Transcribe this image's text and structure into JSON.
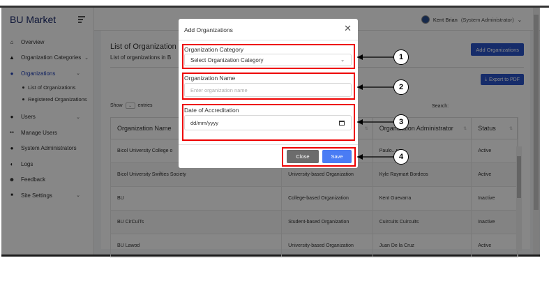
{
  "app": {
    "brand": "BU Market"
  },
  "header": {
    "user_name": "Kent Brian",
    "user_role": "(System Administrator)",
    "chevron": "⌄"
  },
  "sidebar": {
    "items": [
      {
        "label": "Overview",
        "icon": "home-icon",
        "glyph": "⌂"
      },
      {
        "label": "Organization Categories",
        "icon": "graduation-cap-icon",
        "glyph": "▲",
        "chevron": "⌄"
      },
      {
        "label": "Organizations",
        "icon": "user-icon",
        "glyph": "●",
        "chevron": "⌄",
        "active": true
      },
      {
        "label": "Users",
        "icon": "user-icon",
        "glyph": "●",
        "chevron": "⌄"
      },
      {
        "label": "Manage Users",
        "icon": "users-icon",
        "glyph": "●●"
      },
      {
        "label": "System Administrators",
        "icon": "user-shield-icon",
        "glyph": "●"
      },
      {
        "label": "Logs",
        "icon": "pie-chart-icon",
        "glyph": "◐"
      },
      {
        "label": "Feedback",
        "icon": "feedback-icon",
        "glyph": "☻"
      },
      {
        "label": "Site Settings",
        "icon": "settings-icon",
        "glyph": "■",
        "chevron": "⌄"
      }
    ],
    "sub_items": [
      "List of Organizations",
      "Registered Organizations"
    ]
  },
  "main": {
    "title": "List of Organization",
    "subtitle": "List of organizations in B",
    "add_button": "Add Organizations",
    "export_button": "Export to PDF",
    "show_label": "Show",
    "entries_label": "entries",
    "search_label": "Search:",
    "columns": [
      "Organization Name",
      "",
      "Organization Administrator",
      "Status"
    ],
    "rows": [
      {
        "name": "Bicol University College o",
        "type": "",
        "admin": "Paulo...ng",
        "status": "Active"
      },
      {
        "name": "Bicol University Swifties Society",
        "type": "University-based Organization",
        "admin": "Kyle Raymart Bordeos",
        "status": "Active"
      },
      {
        "name": "BU",
        "type": "College-based Organization",
        "admin": "Kent Guevarra",
        "status": "Inactive"
      },
      {
        "name": "BU CirCuiTs",
        "type": "Student-based Organization",
        "admin": "Cuircuits Cuircuits",
        "status": "Inactive"
      },
      {
        "name": "BU Lawod",
        "type": "University-based Organization",
        "admin": "Juan De la Cruz",
        "status": "Active"
      }
    ]
  },
  "modal": {
    "title": "Add Organizations",
    "category_label": "Organization Category",
    "category_value": "Select Organization Category",
    "name_label": "Organization Name",
    "name_placeholder": "Enter organization name",
    "date_label": "Date of Accreditation",
    "date_value": "dd/mm/yyyy",
    "close_button": "Close",
    "save_button": "Save"
  },
  "callouts": [
    "1",
    "2",
    "3",
    "4"
  ],
  "colors": {
    "primary": "#2b53c9",
    "save": "#4a7cf4",
    "highlight": "#e00000",
    "close_btn": "#6c6c6c"
  }
}
